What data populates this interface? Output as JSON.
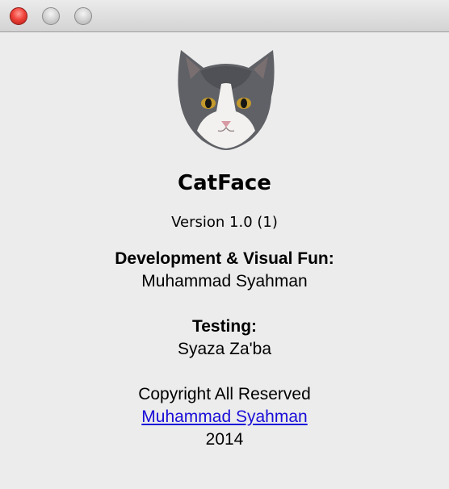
{
  "window": {
    "controls": {
      "close": "close",
      "minimize": "minimize",
      "zoom": "zoom"
    }
  },
  "about": {
    "app_name": "CatFace",
    "version": "Version 1.0 (1)",
    "development_heading": "Development & Visual Fun:",
    "development_name": "Muhammad Syahman",
    "testing_heading": "Testing:",
    "testing_name": "Syaza Za'ba",
    "copyright": "Copyright All Reserved",
    "author_link": "Muhammad Syahman",
    "year": "2014"
  },
  "icons": {
    "app_icon": "cat-face-icon"
  },
  "colors": {
    "background": "#ececec",
    "link": "#1a0dd8",
    "close_button": "#f0433a"
  }
}
